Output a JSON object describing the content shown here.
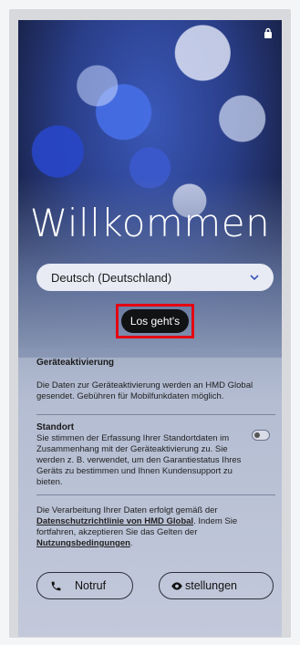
{
  "welcome": {
    "title": "Willkommen"
  },
  "language": {
    "selected": "Deutsch (Deutschland)"
  },
  "start_button": {
    "label": "Los geht's"
  },
  "device_activation": {
    "heading": "Geräteaktivierung",
    "text": "Die Daten zur Geräteaktivierung werden an HMD Global gesendet. Gebühren für Mobilfunkdaten möglich."
  },
  "location": {
    "heading": "Standort",
    "text": "Sie stimmen der Erfassung Ihrer Standortdaten im Zusammenhang mit der Geräteaktivierung zu. Sie werden z. B. verwendet, um den Garantiestatus Ihres Geräts zu bestimmen und Ihnen Kundensupport zu bieten.",
    "enabled": false
  },
  "privacy": {
    "text_before": "Die Verarbeitung Ihrer Daten erfolgt gemäß der ",
    "privacy_link": "Datenschutzrichtlinie von HMD Global",
    "text_middle": ". Indem Sie fortfahren, akzeptieren Sie das Gelten der ",
    "terms_link": "Nutzungsbedingungen",
    "text_after": "."
  },
  "bottom": {
    "emergency_label": "Notruf",
    "settings_label": "stellungen"
  },
  "colors": {
    "highlight": "#e30613",
    "accent": "#3b56b8"
  }
}
